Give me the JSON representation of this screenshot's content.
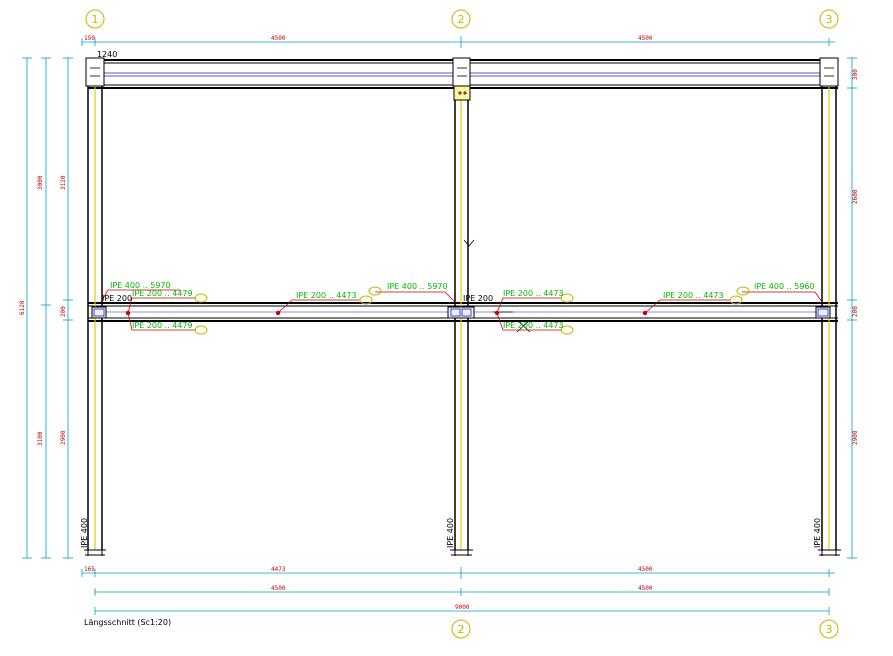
{
  "grid_axes": {
    "top": [
      "1",
      "2",
      "3"
    ],
    "bottom": [
      "2",
      "3"
    ]
  },
  "dims": {
    "top_row": [
      "150",
      "4500",
      "4500"
    ],
    "left_outer": [
      "3000",
      "6120",
      "3100"
    ],
    "left_inner": [
      "3120",
      "200",
      "2900"
    ],
    "right": [
      "300",
      "2600",
      "200",
      "2900"
    ],
    "bottom_row1": [
      "165",
      "4473",
      "4500"
    ],
    "bottom_row2": [
      "4500",
      "4500"
    ],
    "bottom_total": "9000"
  },
  "top_note": "1240",
  "beam_labels": {
    "l1": "IPE 400 .. 5970",
    "l2": "IPE 200 .. 4479",
    "l3": "IPE 200 .. 4479",
    "l4": "IPE 200 .. 4473",
    "l5": "IPE 400 .. 5970",
    "l6": "IPE 200 .. 4473",
    "l7": "IPE 200 .. 4473",
    "l8": "IPE 200 .. 4473",
    "l9": "IPE 400 .. 5960"
  },
  "joint_labels": [
    "IPE 200",
    "IPE 200"
  ],
  "column_labels": [
    "IPE 400",
    "IPE 400",
    "IPE 400"
  ],
  "caption": "Längsschnitt (Sc1:20)",
  "colors": {
    "dimension": "#00a0c8",
    "dim_text": "#cc0000",
    "label": "#00bb00",
    "marker": "#c8b400",
    "brace": "#2222aa",
    "steel": "#000000"
  }
}
